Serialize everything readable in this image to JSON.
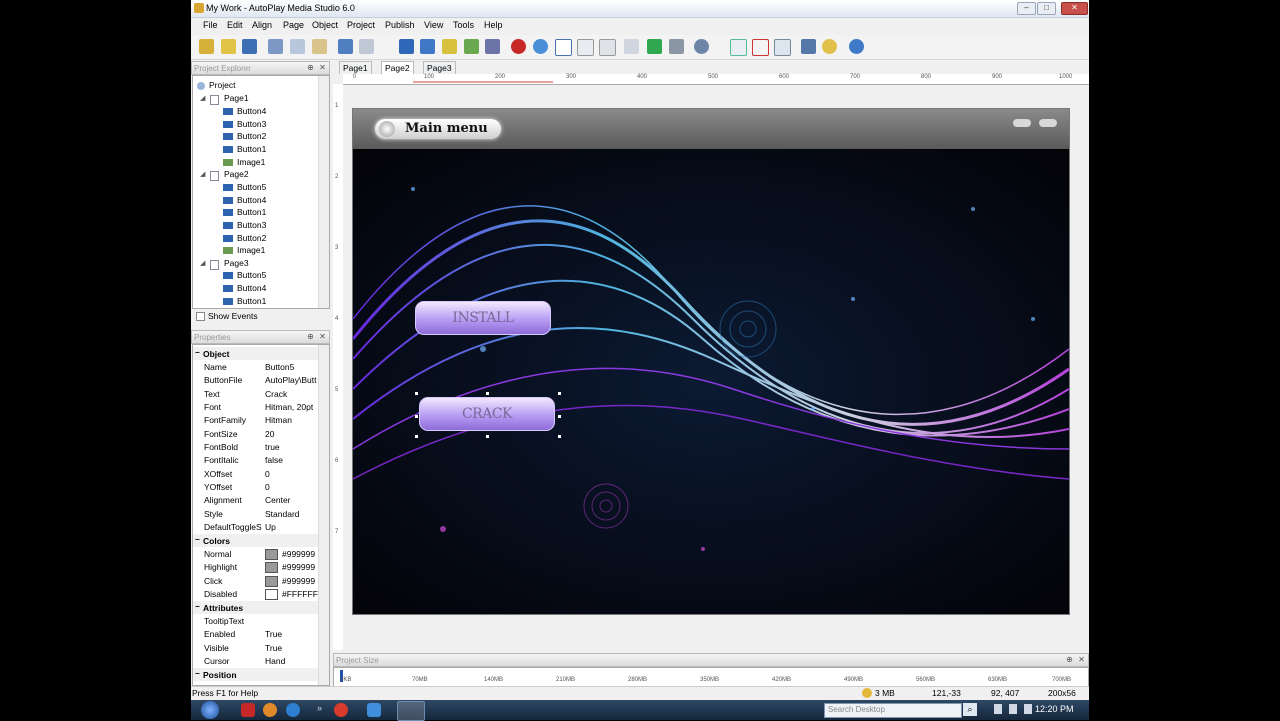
{
  "window": {
    "title": "My Work - AutoPlay Media Studio 6.0",
    "min": "–",
    "max": "□",
    "close": "✕"
  },
  "menu": [
    "File",
    "Edit",
    "Align",
    "Page",
    "Object",
    "Project",
    "Publish",
    "View",
    "Tools",
    "Help"
  ],
  "project_explorer": {
    "title": "Project Explorer",
    "items": [
      {
        "label": "Project",
        "level": 0,
        "type": "project"
      },
      {
        "label": "Page1",
        "level": 1,
        "type": "page"
      },
      {
        "label": "Button4",
        "level": 2,
        "type": "button"
      },
      {
        "label": "Button3",
        "level": 2,
        "type": "button"
      },
      {
        "label": "Button2",
        "level": 2,
        "type": "button"
      },
      {
        "label": "Button1",
        "level": 2,
        "type": "button"
      },
      {
        "label": "Image1",
        "level": 2,
        "type": "image"
      },
      {
        "label": "Page2",
        "level": 1,
        "type": "page"
      },
      {
        "label": "Button5",
        "level": 2,
        "type": "button"
      },
      {
        "label": "Button4",
        "level": 2,
        "type": "button"
      },
      {
        "label": "Button1",
        "level": 2,
        "type": "button"
      },
      {
        "label": "Button3",
        "level": 2,
        "type": "button"
      },
      {
        "label": "Button2",
        "level": 2,
        "type": "button"
      },
      {
        "label": "Image1",
        "level": 2,
        "type": "image"
      },
      {
        "label": "Page3",
        "level": 1,
        "type": "page"
      },
      {
        "label": "Button5",
        "level": 2,
        "type": "button"
      },
      {
        "label": "Button4",
        "level": 2,
        "type": "button"
      },
      {
        "label": "Button1",
        "level": 2,
        "type": "button"
      }
    ],
    "show_events": "Show Events"
  },
  "properties": {
    "title": "Properties",
    "rows": [
      {
        "cat": "Object"
      },
      {
        "k": "Name",
        "v": "Button5"
      },
      {
        "k": "ButtonFile",
        "v": "AutoPlay\\Butt"
      },
      {
        "k": "Text",
        "v": "Crack"
      },
      {
        "k": "Font",
        "v": "Hitman, 20pt"
      },
      {
        "k": "FontFamily",
        "v": "Hitman"
      },
      {
        "k": "FontSize",
        "v": "20"
      },
      {
        "k": "FontBold",
        "v": "true"
      },
      {
        "k": "FontItalic",
        "v": "false"
      },
      {
        "k": "XOffset",
        "v": "0"
      },
      {
        "k": "YOffset",
        "v": "0"
      },
      {
        "k": "Alignment",
        "v": "Center"
      },
      {
        "k": "Style",
        "v": "Standard"
      },
      {
        "k": "DefaultToggleS",
        "v": "Up"
      },
      {
        "cat": "Colors"
      },
      {
        "k": "Normal",
        "v": "#999999",
        "swatch": "#999999"
      },
      {
        "k": "Highlight",
        "v": "#999999",
        "swatch": "#999999"
      },
      {
        "k": "Click",
        "v": "#999999",
        "swatch": "#999999"
      },
      {
        "k": "Disabled",
        "v": "#FFFFFF",
        "swatch": "#FFFFFF"
      },
      {
        "cat": "Attributes"
      },
      {
        "k": "TooltipText",
        "v": ""
      },
      {
        "k": "Enabled",
        "v": "True"
      },
      {
        "k": "Visible",
        "v": "True"
      },
      {
        "k": "Cursor",
        "v": "Hand"
      },
      {
        "cat": "Position"
      }
    ]
  },
  "tabs": [
    "Page1",
    "Page2",
    "Page3"
  ],
  "ruler": [
    "0",
    "100",
    "200",
    "300",
    "400",
    "500",
    "600",
    "700",
    "800",
    "900",
    "1000"
  ],
  "vruler": [
    "1",
    "2",
    "3",
    "4",
    "5",
    "6",
    "7"
  ],
  "stage": {
    "main_menu": "Main menu",
    "install": "INSTALL",
    "crack": "CRACK"
  },
  "bottom_panel": {
    "title": "Project Size",
    "ticks": [
      "0KB",
      "70MB",
      "140MB",
      "210MB",
      "280MB",
      "350MB",
      "420MB",
      "490MB",
      "560MB",
      "630MB",
      "700MB"
    ]
  },
  "status": {
    "help": "Press F1 for Help",
    "size": "3 MB",
    "coords": "121,-33",
    "pos": "92, 407",
    "dims": "200x56"
  },
  "taskbar": {
    "search": "Search Desktop",
    "clock": "12:20 PM"
  },
  "colors": {
    "accent": "#3a7bd5",
    "titlebar": "#dfe7f2"
  }
}
